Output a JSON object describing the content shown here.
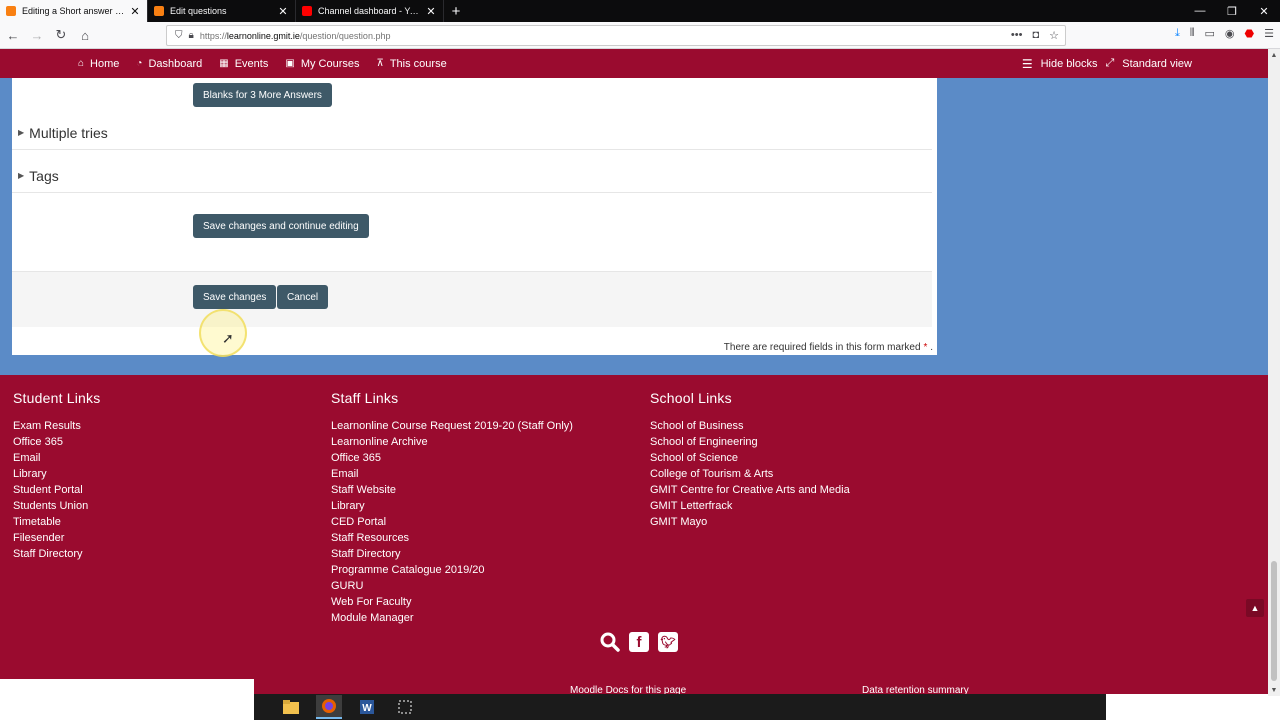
{
  "browser": {
    "tabs": [
      {
        "title": "Editing a Short answer question",
        "active": true,
        "favicon_color": "#f98012"
      },
      {
        "title": "Edit questions",
        "active": false,
        "favicon_color": "#f98012"
      },
      {
        "title": "Channel dashboard - YouTube",
        "active": false,
        "favicon_color": "#ff0000"
      }
    ],
    "new_tab": "+",
    "url_scheme": "https://",
    "url_host": "learnonline.gmit.ie",
    "url_path": "/question/question.php"
  },
  "moodle_nav": {
    "items": [
      {
        "icon": "home-icon",
        "glyph": "⌂",
        "label": "Home"
      },
      {
        "icon": "dashboard-icon",
        "glyph": "◔",
        "label": "Dashboard"
      },
      {
        "icon": "calendar-icon",
        "glyph": "▦",
        "label": "Events"
      },
      {
        "icon": "briefcase-icon",
        "glyph": "▣",
        "label": "My Courses"
      },
      {
        "icon": "sitemap-icon",
        "glyph": "⊼",
        "label": "This course"
      }
    ],
    "hide_blocks": "Hide blocks",
    "standard_view": "Standard view"
  },
  "form": {
    "blanks_button": "Blanks for 3 More Answers",
    "sections": [
      "Multiple tries",
      "Tags"
    ],
    "save_continue_button": "Save changes and continue editing",
    "save_button": "Save changes",
    "cancel_button": "Cancel",
    "required_note": "There are required fields in this form marked",
    "required_mark": "*",
    "required_period": "."
  },
  "footer": {
    "student": {
      "heading": "Student Links",
      "links": [
        "Exam Results",
        "Office 365",
        "Email",
        "Library",
        "Student Portal",
        "Students Union",
        "Timetable",
        "Filesender",
        "Staff Directory"
      ]
    },
    "staff": {
      "heading": "Staff Links",
      "links": [
        "Learnonline Course Request 2019-20 (Staff Only)",
        "Learnonline Archive",
        "Office 365",
        "Email",
        "Staff Website",
        "Library",
        "CED Portal",
        "Staff Resources",
        "Staff Directory",
        "Programme Catalogue 2019/20",
        "GURU",
        "Web For Faculty",
        "Module Manager"
      ]
    },
    "school": {
      "heading": "School Links",
      "links": [
        "School of Business",
        "School of Engineering",
        "School of Science",
        "College of Tourism & Arts",
        "GMIT Centre for Creative Arts and Media",
        "GMIT Letterfrack",
        "GMIT Mayo"
      ]
    },
    "moodle_docs": "Moodle Docs for this page",
    "data_retention": "Data retention summary"
  },
  "colors": {
    "brand": "#9a0b2f",
    "content_bg": "#5b8bc7",
    "button": "#3e5968"
  }
}
